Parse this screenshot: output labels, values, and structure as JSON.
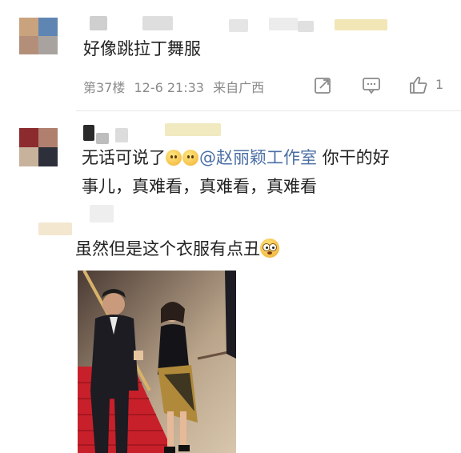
{
  "comment1": {
    "text": "好像跳拉丁舞服",
    "floor": "第37楼",
    "time": "12-6 21:33",
    "location": "来自广西",
    "like_count": "1"
  },
  "comment2": {
    "text_prefix": "无话可说了",
    "mention": "@赵丽颖工作室",
    "text_suffix": " 你干的好",
    "text_line2": "事儿，真难看，真难看，真难看"
  },
  "comment3": {
    "text": "虽然但是这个衣服有点丑"
  },
  "icons": {
    "share": "share-icon",
    "comment": "comment-icon",
    "like": "thumbs-up-icon"
  },
  "colors": {
    "mention": "#4a6fa5",
    "meta": "#8a8a8a",
    "carpet": "#c8202a"
  }
}
